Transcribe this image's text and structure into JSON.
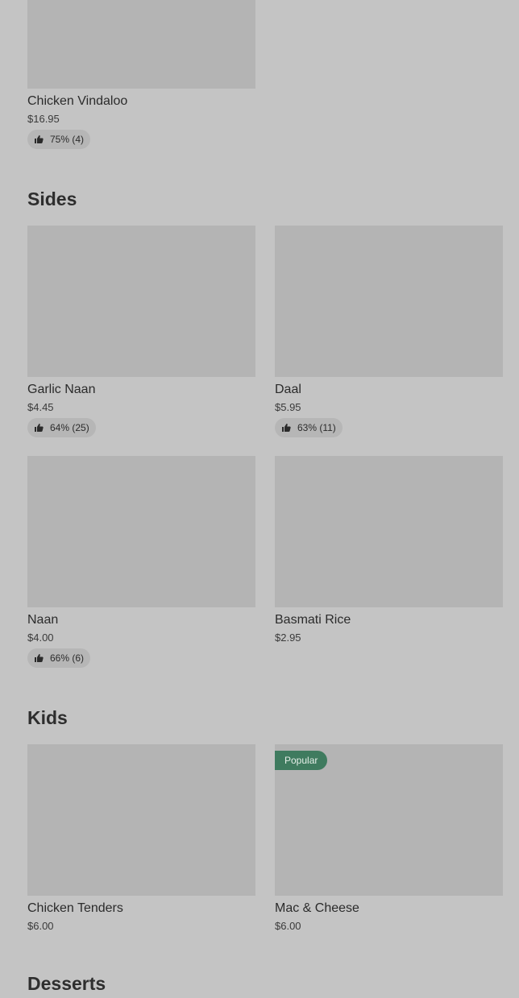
{
  "sections": [
    {
      "title": "",
      "items": [
        {
          "name": "Chicken Vindaloo",
          "price": "$16.95",
          "rating": "75% (4)"
        }
      ]
    },
    {
      "title": "Sides",
      "items": [
        {
          "name": "Garlic Naan",
          "price": "$4.45",
          "rating": "64% (25)"
        },
        {
          "name": "Daal",
          "price": "$5.95",
          "rating": "63% (11)"
        },
        {
          "name": "Naan",
          "price": "$4.00",
          "rating": "66% (6)"
        },
        {
          "name": "Basmati Rice",
          "price": "$2.95"
        }
      ]
    },
    {
      "title": "Kids",
      "items": [
        {
          "name": "Chicken Tenders",
          "price": "$6.00"
        },
        {
          "name": "Mac & Cheese",
          "price": "$6.00",
          "badge": "Popular"
        }
      ]
    },
    {
      "title": "Desserts",
      "items": []
    }
  ],
  "icons": {
    "rating": "thumbs-up-icon"
  },
  "colors": {
    "background": "#c4c4c4",
    "image_placeholder": "#b4b4b4",
    "rating_pill": "#b6b6b6",
    "popular_badge": "#3f7b5f"
  }
}
